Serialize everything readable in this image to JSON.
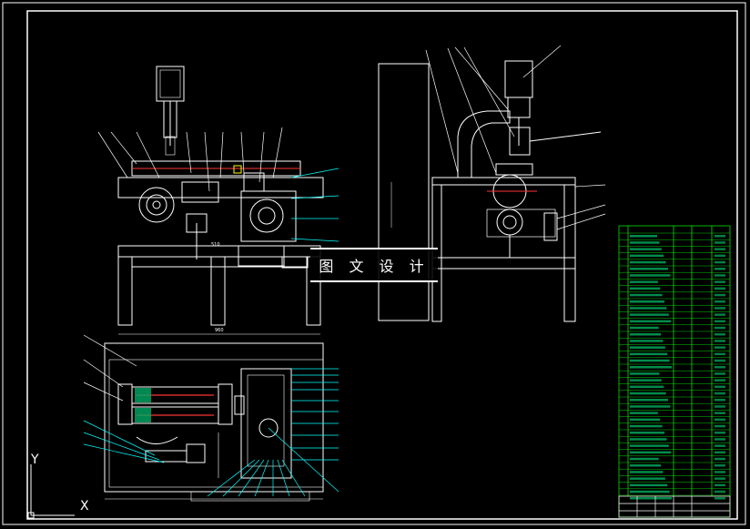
{
  "watermark": {
    "text": "图 文 设 计"
  },
  "ucs": {
    "x_label": "X",
    "y_label": "Y"
  },
  "dims": {
    "front_width": "960",
    "front_small": "510"
  },
  "colors": {
    "background": "#000000",
    "lines": "#ffffff",
    "leaders": "#00ffff",
    "table": "#00ff00",
    "hatch": "#ff3333",
    "accent": "#ffff00"
  }
}
